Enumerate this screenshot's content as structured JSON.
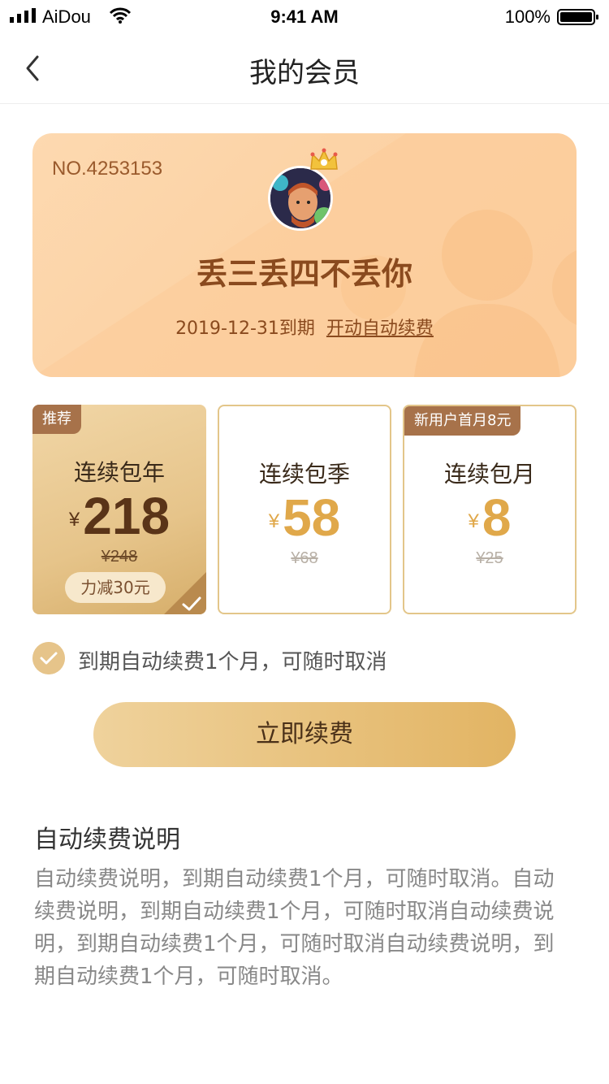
{
  "status_bar": {
    "carrier": "AiDou",
    "time": "9:41 AM",
    "battery": "100%"
  },
  "nav": {
    "title": "我的会员",
    "back_icon": "chevron-left-icon"
  },
  "member_card": {
    "number": "NO.4253153",
    "name": "丢三丢四不丢你",
    "expire": "2019-12-31到期",
    "auto_renew_link": "开动自动续费"
  },
  "plans": [
    {
      "badge": "推荐",
      "name": "连续包年",
      "currency": "¥",
      "price": "218",
      "original": "¥248",
      "discount": "力减30元",
      "selected": true
    },
    {
      "badge": "",
      "name": "连续包季",
      "currency": "¥",
      "price": "58",
      "original": "¥68",
      "selected": false
    },
    {
      "badge": "新用户首月8元",
      "name": "连续包月",
      "currency": "¥",
      "price": "8",
      "original": "¥25",
      "selected": false
    }
  ],
  "auto_renew": {
    "label": "到期自动续费1个月，可随时取消",
    "checked": true
  },
  "renew_button": "立即续费",
  "explain": {
    "title": "自动续费说明",
    "body": "自动续费说明，到期自动续费1个月，可随时取消。自动续费说明，到期自动续费1个月，可随时取消自动续费说明，到期自动续费1个月，可随时取消自动续费说明，到期自动续费1个月，可随时取消。"
  },
  "colors": {
    "accent": "#e2b463",
    "card_bg": "#fcd3a6",
    "brown_text": "#8a4a1e"
  }
}
